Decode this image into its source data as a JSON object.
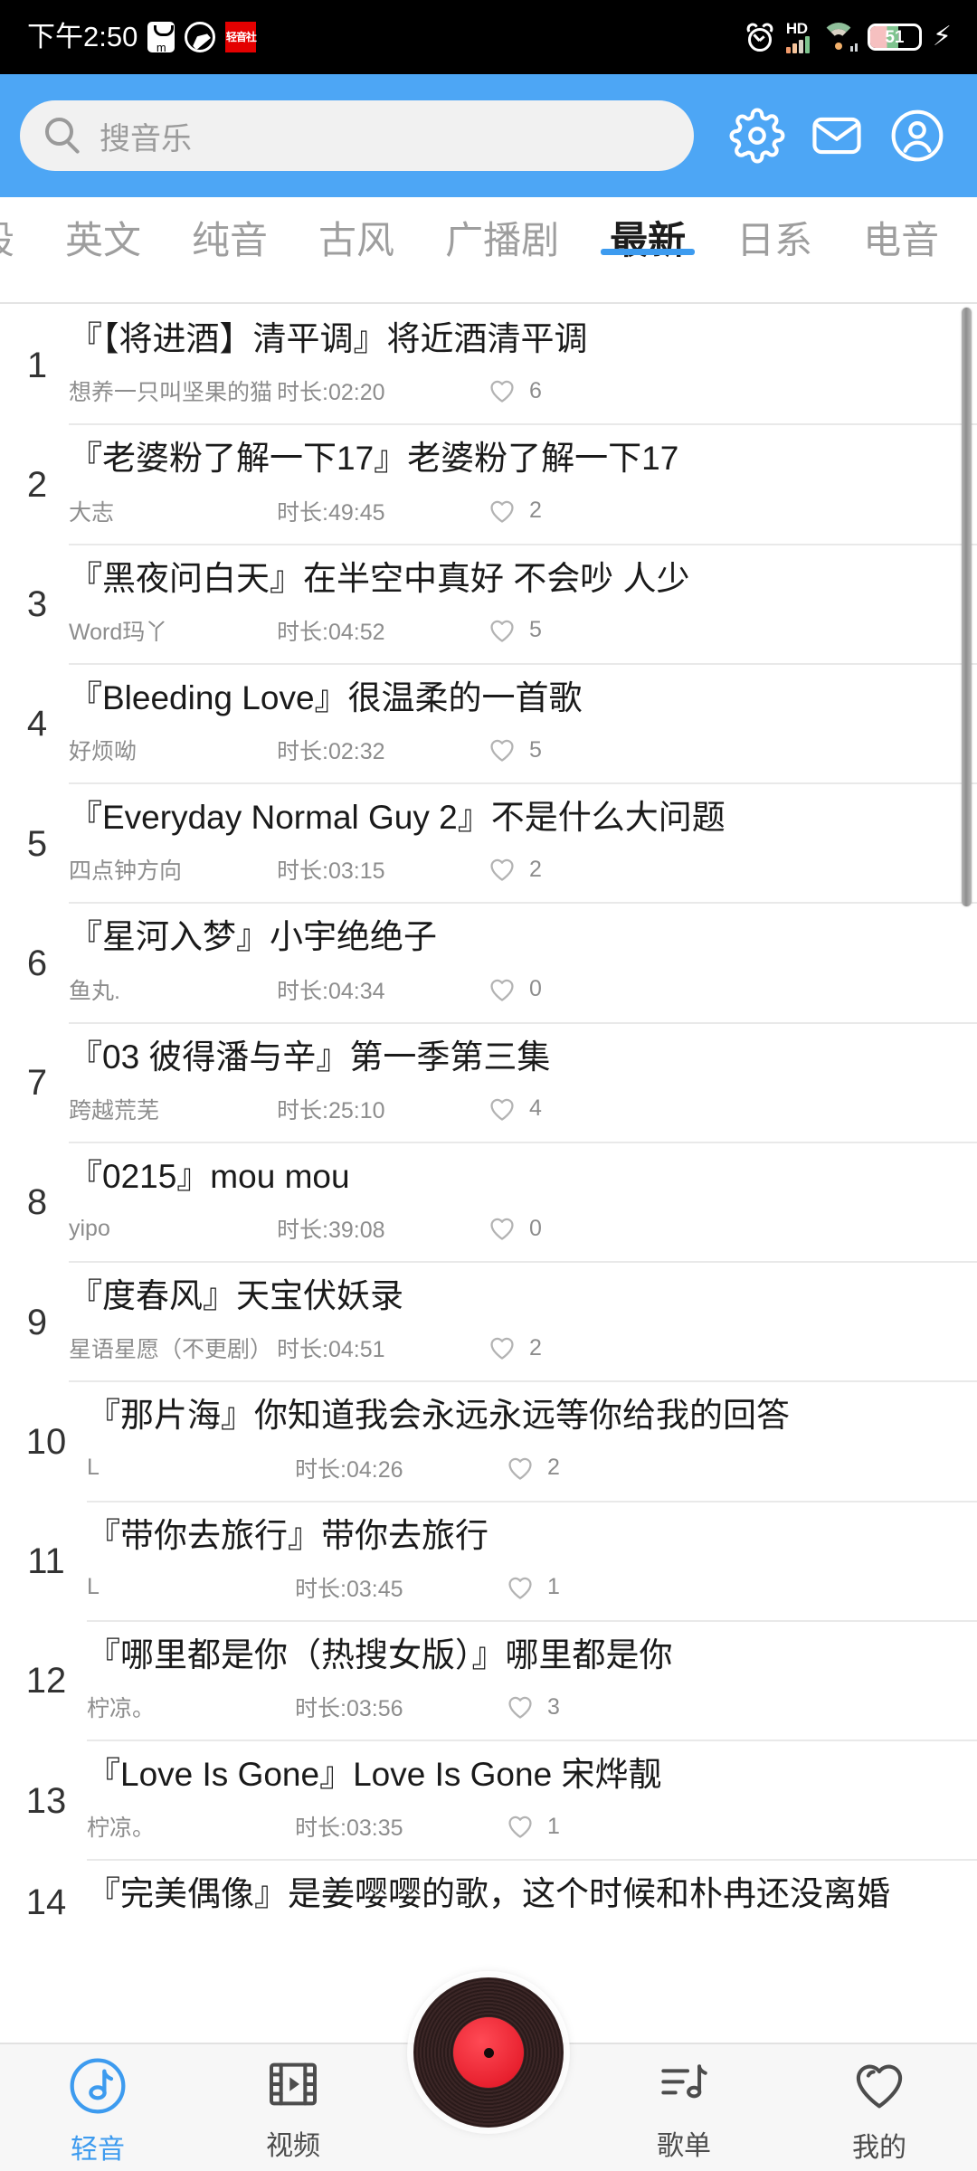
{
  "status_bar": {
    "time": "下午2:50",
    "left_icons": [
      "mi-app-icon",
      "circle-slash-icon",
      "qingyinshe-badge-icon"
    ],
    "badge_text": "轻音社",
    "network_label": "HD",
    "battery_percent": "51",
    "right_icons": [
      "alarm-icon",
      "hd-signal-icon",
      "wifi-icon",
      "battery-icon",
      "charging-bolt-icon"
    ]
  },
  "header": {
    "search": {
      "placeholder": "搜音乐",
      "value": ""
    },
    "icons": [
      "gear-icon",
      "mail-icon",
      "account-icon"
    ],
    "accent_color": "#4da6f5"
  },
  "tabs": {
    "items": [
      {
        "label": "段",
        "active": false,
        "partial": true
      },
      {
        "label": "英文",
        "active": false
      },
      {
        "label": "纯音",
        "active": false
      },
      {
        "label": "古风",
        "active": false
      },
      {
        "label": "广播剧",
        "active": false
      },
      {
        "label": "最新",
        "active": true
      },
      {
        "label": "日系",
        "active": false
      },
      {
        "label": "电音",
        "active": false
      }
    ],
    "active_underline_color": "#3d9bef"
  },
  "list": {
    "duration_prefix": "时长:",
    "items": [
      {
        "num": "1",
        "title": "『【将进酒】清平调』将近酒清平调",
        "author": "想养一只叫坚果的猫",
        "duration": "时长:02:20",
        "likes": "6"
      },
      {
        "num": "2",
        "title": "『老婆粉了解一下17』老婆粉了解一下17",
        "author": "大志",
        "duration": "时长:49:45",
        "likes": "2"
      },
      {
        "num": "3",
        "title": "『黑夜问白天』在半空中真好 不会吵 人少",
        "author": "Word玛丫",
        "duration": "时长:04:52",
        "likes": "5"
      },
      {
        "num": "4",
        "title": "『Bleeding Love』很温柔的一首歌",
        "author": "好烦呦",
        "duration": "时长:02:32",
        "likes": "5"
      },
      {
        "num": "5",
        "title": "『Everyday Normal Guy 2』不是什么大问题",
        "author": "四点钟方向",
        "duration": "时长:03:15",
        "likes": "2"
      },
      {
        "num": "6",
        "title": "『星河入梦』小宇绝绝子",
        "author": "鱼丸.",
        "duration": "时长:04:34",
        "likes": "0"
      },
      {
        "num": "7",
        "title": "『03 彼得潘与辛』第一季第三集",
        "author": "跨越荒芜",
        "duration": "时长:25:10",
        "likes": "4"
      },
      {
        "num": "8",
        "title": "『0215』mou mou",
        "author": "yipo",
        "duration": "时长:39:08",
        "likes": "0"
      },
      {
        "num": "9",
        "title": "『度春风』天宝伏妖录",
        "author": "星语星愿（不更剧）",
        "duration": "时长:04:51",
        "likes": "2"
      },
      {
        "num": "10",
        "title": "『那片海』你知道我会永远永远等你给我的回答",
        "author": "L",
        "duration": "时长:04:26",
        "likes": "2"
      },
      {
        "num": "11",
        "title": "『带你去旅行』带你去旅行",
        "author": "L",
        "duration": "时长:03:45",
        "likes": "1"
      },
      {
        "num": "12",
        "title": "『哪里都是你（热搜女版）』哪里都是你",
        "author": "柠凉。",
        "duration": "时长:03:56",
        "likes": "3"
      },
      {
        "num": "13",
        "title": "『Love Is Gone』Love Is Gone 宋烨靓",
        "author": "柠凉。",
        "duration": "时长:03:35",
        "likes": "1"
      },
      {
        "num": "14",
        "title": "『完美偶像』是姜嘤嘤的歌，这个时候和朴冉还没离婚",
        "author": "",
        "duration": "",
        "likes": ""
      }
    ]
  },
  "bottom_nav": {
    "items": [
      {
        "label": "轻音",
        "icon": "music-note-circle-icon",
        "active": true
      },
      {
        "label": "视频",
        "icon": "film-play-icon",
        "active": false
      },
      {
        "label": "",
        "icon": "vinyl-record-icon",
        "active": false
      },
      {
        "label": "歌单",
        "icon": "playlist-note-icon",
        "active": false
      },
      {
        "label": "我的",
        "icon": "heart-icon",
        "active": false
      }
    ],
    "active_color": "#3d9bef"
  }
}
